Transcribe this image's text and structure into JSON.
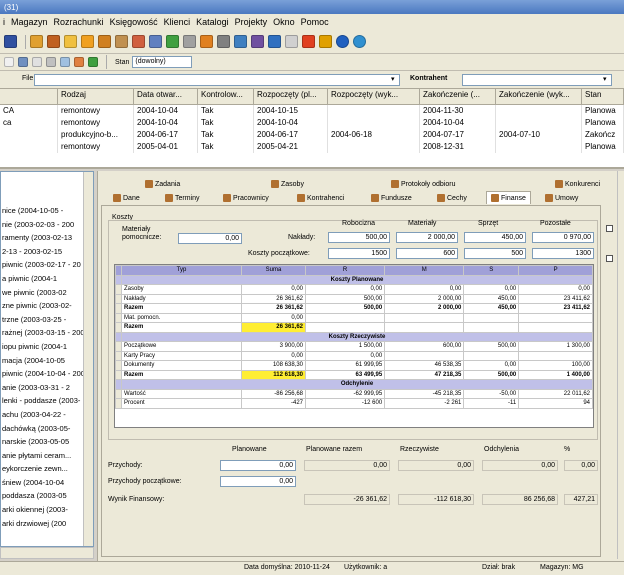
{
  "window": {
    "title": "(31)"
  },
  "menu": [
    "i",
    "Magazyn",
    "Rozrachunki",
    "Księgowość",
    "Klienci",
    "Katalogi",
    "Projekty",
    "Okno",
    "Pomoc"
  ],
  "toolbar3": {
    "stan_label": "Stan",
    "stan_value": "(dowolny)"
  },
  "filter": {
    "label": "Kontrahent",
    "value": ""
  },
  "grid": {
    "columns": [
      "Rodzaj",
      "Data otwar...",
      "Kontrolow...",
      "Rozpoczęty (pl...",
      "Rozpoczęty (wyk...",
      "Zakończenie (...",
      "Zakończenie (wyk...",
      "Stan"
    ],
    "rows": [
      [
        "CA",
        "remontowy",
        "2004-10-04",
        "Tak",
        "2004-10-15",
        "",
        "2004-11-30",
        "",
        "Planowa"
      ],
      [
        "ca",
        "remontowy",
        "2004-10-04",
        "Tak",
        "2004-10-04",
        "",
        "2004-10-04",
        "",
        "Planowa"
      ],
      [
        "",
        "produkcyjno-b...",
        "2004-06-17",
        "Tak",
        "2004-06-17",
        "2004-06-18",
        "2004-07-17",
        "2004-07-10",
        "Zakończ"
      ],
      [
        "",
        "remontowy",
        "2005-04-01",
        "Tak",
        "2005-04-21",
        "",
        "2008-12-31",
        "",
        "Planowa"
      ]
    ]
  },
  "tree": [
    "nice (2004-10-05 -",
    "nie (2003-02-03 - 200",
    "ramenty (2003-02-13",
    "2-13 - 2003-02-15",
    "piwnic (2003-02-17 - 20",
    "a piwnic (2004-1",
    "we piwnic (2003-02",
    "zne piwnic (2003-02-",
    "trzne (2003-03-25 -",
    "rażnej (2003-03-15 - 2003",
    "iopu piwnic (2004-1",
    "macja (2004-10-05",
    "piwnic (2004-10-04 - 200",
    "anie (2003-03-31 - 2",
    "lenki - poddasze (2003-",
    "achu (2003-04-22 -",
    "dachówką (2003-05-",
    "narskie (2003-05-05",
    "anie płytami ceram...",
    "eykorczenie zewn...",
    "śniew (2004-10-04",
    "poddasza (2003-05",
    "arki okiennej (2003-",
    "arki drzwiowej (200"
  ],
  "tabs_row1": [
    "Zadania",
    "Zasoby",
    "Protokoły odbioru",
    "Konkurenci"
  ],
  "tabs_row2": [
    "Dane",
    "Terminy",
    "Pracownicy",
    "Kontrahenci",
    "Fundusze",
    "Cechy",
    "Finanse",
    "Umowy"
  ],
  "koszty": {
    "group_label": "Koszty",
    "materialy_label": "Materiały pomocnicze:",
    "materialy_value": "0,00",
    "naklady_label": "Nakłady:",
    "kp_label": "Koszty początkowe:",
    "col_headers": [
      "Robocizna",
      "Materiały",
      "Sprzęt",
      "Pozostałe"
    ],
    "naklady": [
      "500,00",
      "2 000,00",
      "450,00",
      "0 970,00"
    ],
    "kp": [
      "1500",
      "600",
      "500",
      "1300"
    ]
  },
  "fin_table": {
    "headers": [
      "Typ",
      "Suma",
      "R",
      "M",
      "S",
      "P"
    ],
    "rows": [
      {
        "kind": "sect",
        "cells": [
          "Koszty Planowane"
        ]
      },
      {
        "kind": "row",
        "cells": [
          "Zasoby",
          "0,00",
          "0,00",
          "0,00",
          "0,00",
          "0,00"
        ]
      },
      {
        "kind": "row",
        "cells": [
          "Nakłady",
          "26 361,62",
          "500,00",
          "2 000,00",
          "450,00",
          "23 411,62"
        ]
      },
      {
        "kind": "bold",
        "cells": [
          "Razem",
          "26 361,62",
          "500,00",
          "2 000,00",
          "450,00",
          "23 411,62"
        ]
      },
      {
        "kind": "row",
        "cells": [
          "Mat. pomocn.",
          "0,00",
          "",
          "",
          "",
          ""
        ]
      },
      {
        "kind": "hl",
        "cells": [
          "Razem",
          "26 361,62",
          "",
          "",
          "",
          ""
        ]
      },
      {
        "kind": "sect",
        "cells": [
          "Koszty Rzeczywiste"
        ]
      },
      {
        "kind": "row",
        "cells": [
          "Początkowe",
          "3 900,00",
          "1 500,00",
          "600,00",
          "500,00",
          "1 300,00"
        ]
      },
      {
        "kind": "row",
        "cells": [
          "Karty Pracy",
          "0,00",
          "0,00",
          "",
          "",
          ""
        ]
      },
      {
        "kind": "row",
        "cells": [
          "Dokumenty",
          "108 638,30",
          "61 999,95",
          "46 538,35",
          "0,00",
          "100,00"
        ]
      },
      {
        "kind": "hl",
        "cells": [
          "Razem",
          "112 618,30",
          "63 499,95",
          "47 218,35",
          "500,00",
          "1 400,00"
        ]
      },
      {
        "kind": "sect",
        "cells": [
          "Odchylenie"
        ]
      },
      {
        "kind": "row",
        "cells": [
          "Wartość",
          "-86 256,68",
          "-62 999,95",
          "-45 218,35",
          "-50,00",
          "22 011,62"
        ]
      },
      {
        "kind": "row",
        "cells": [
          "Procent",
          "-427",
          "-12 600",
          "-2 261",
          "-11",
          "94"
        ]
      }
    ]
  },
  "summary": {
    "headers": [
      "Planowane",
      "Planowane razem",
      "Rzeczywiste",
      "Odchylenia",
      "%"
    ],
    "przychody_label": "Przychody:",
    "przychody": [
      "0,00",
      "0,00",
      "0,00",
      "0,00",
      "0,00"
    ],
    "pp_label": "Przychody początkowe:",
    "pp_value": "0,00",
    "wynik_label": "Wynik Finansowy:",
    "wynik": [
      "-26 361,62",
      "-112 618,30",
      "86 256,68",
      "427,21"
    ]
  },
  "statusbar": {
    "date": "Data domyślna: 2010-11-24",
    "user": "Użytkownik: a",
    "dept": "Dział: brak",
    "warehouse": "Magazyn: MG"
  },
  "colors": {
    "accent": "#316ac5",
    "highlight": "#ffee33",
    "section": "#c0c0e8"
  }
}
